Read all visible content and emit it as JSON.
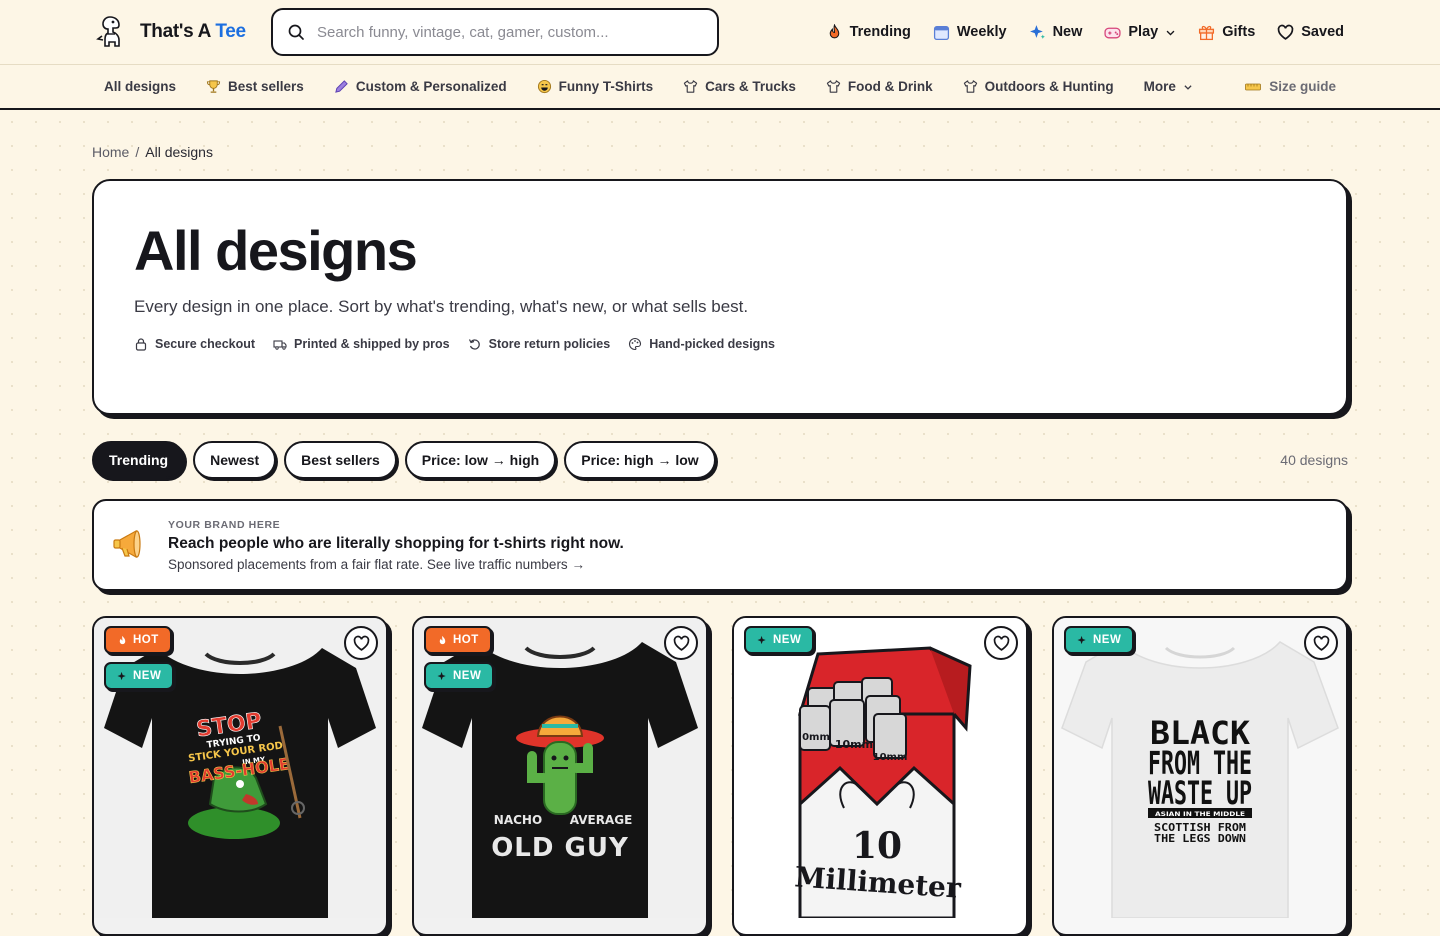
{
  "brand": {
    "name_main": "That's A",
    "name_accent": "Tee",
    "accent_color": "#1c6fe0"
  },
  "search": {
    "placeholder": "Search funny, vintage, cat, gamer, custom..."
  },
  "nav": {
    "trending": "Trending",
    "weekly": "Weekly",
    "new": "New",
    "play": "Play",
    "gifts": "Gifts",
    "saved": "Saved"
  },
  "categories": [
    {
      "label": "All designs"
    },
    {
      "label": "Best sellers"
    },
    {
      "label": "Custom & Personalized"
    },
    {
      "label": "Funny T-Shirts"
    },
    {
      "label": "Cars & Trucks"
    },
    {
      "label": "Food & Drink"
    },
    {
      "label": "Outdoors & Hunting"
    },
    {
      "label": "More"
    }
  ],
  "size_guide": "Size guide",
  "breadcrumb": {
    "home": "Home",
    "separator": "/",
    "current": "All designs"
  },
  "hero": {
    "title": "All designs",
    "subtitle": "Every design in one place. Sort by what's trending, what's new, or what sells best.",
    "trust": [
      "Secure checkout",
      "Printed & shipped by pros",
      "Store return policies",
      "Hand-picked designs"
    ]
  },
  "sort": {
    "options": [
      "Trending",
      "Newest",
      "Best sellers",
      "Price: low → high",
      "Price: high → low"
    ],
    "active": "Trending",
    "count": "40 designs"
  },
  "ad": {
    "eyebrow": "YOUR BRAND HERE",
    "headline": "Reach people who are literally shopping for t-shirts right now.",
    "sub": "Sponsored placements from a fair flat rate. See live traffic numbers →"
  },
  "badges": {
    "hot": "HOT",
    "new": "NEW"
  },
  "products": [
    {
      "badges": [
        "HOT",
        "NEW"
      ],
      "art_lines": [
        "STOP",
        "TRYING TO",
        "STICK YOUR ROD",
        "IN MY",
        "BASS-HOLE"
      ],
      "shirt_color": "#141414"
    },
    {
      "badges": [
        "HOT",
        "NEW"
      ],
      "art_lines": [
        "NACHO",
        "AVERAGE",
        "OLD GUY"
      ],
      "shirt_color": "#141414"
    },
    {
      "badges": [
        "NEW"
      ],
      "art_lines": [
        "0mm",
        "10mm",
        "10mm",
        "10",
        "Millimeter"
      ],
      "shirt_color": "#ffffff"
    },
    {
      "badges": [
        "NEW"
      ],
      "art_lines": [
        "BLACK",
        "FROM THE",
        "WASTE UP",
        "ASIAN IN THE MIDDLE",
        "SCOTTISH FROM",
        "THE LEGS DOWN"
      ],
      "shirt_color": "#eeeeee"
    }
  ],
  "colors": {
    "background": "#fdf6e6",
    "ink": "#17171c",
    "hot": "#f26a28",
    "new": "#2ab9a4"
  }
}
